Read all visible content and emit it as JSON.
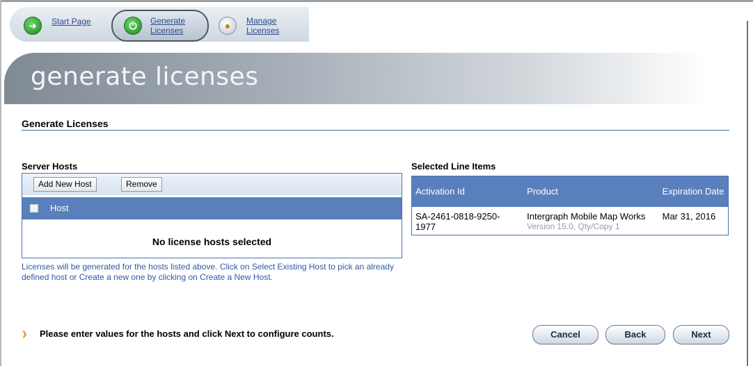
{
  "nav": {
    "items": [
      {
        "label": "Start Page",
        "icon": "arrow-right-icon"
      },
      {
        "label_line1": "Generate",
        "label_line2": "Licenses",
        "icon": "generate-licenses-icon"
      },
      {
        "label_line1": "Manage",
        "label_line2": "Licenses",
        "icon": "manage-licenses-icon"
      }
    ]
  },
  "banner": {
    "title": "generate licenses"
  },
  "page": {
    "title": "Generate Licenses"
  },
  "server_hosts": {
    "title": "Server Hosts",
    "add_button": "Add New Host",
    "remove_button": "Remove",
    "column_host": "Host",
    "empty_message": "No license hosts selected",
    "help_text": "Licenses will be generated for the hosts listed above. Click on Select Existing Host to pick an already defined host or Create a new one by clicking on Create a New Host."
  },
  "line_items": {
    "title": "Selected Line Items",
    "columns": [
      "Activation Id",
      "Product",
      "Expiration Date"
    ],
    "rows": [
      {
        "activation_id": "SA-2461-0818-9250-1977",
        "product": "Intergraph Mobile Map Works",
        "product_detail": "Version 15.0, Qty/Copy 1",
        "expiration": "Mar 31, 2016"
      }
    ]
  },
  "footer": {
    "hint": "Please enter values for the hosts and click Next to configure counts.",
    "cancel": "Cancel",
    "back": "Back",
    "next": "Next"
  },
  "colors": {
    "header_blue": "#5a7fbd",
    "link_blue": "#2d5aa0",
    "hint_orange": "#e08000"
  }
}
